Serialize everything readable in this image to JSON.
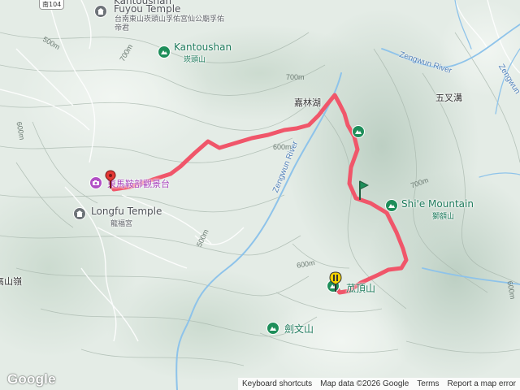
{
  "map": {
    "road_shield": "南104",
    "contours": [
      "700m",
      "700m",
      "600m",
      "600m",
      "600m",
      "500m",
      "500m",
      "700m",
      "600m"
    ],
    "rivers": {
      "zengwun_diag": "Zengwun River",
      "zengwun_top": "Zengwun River",
      "zengwun_right": "Zengwun"
    },
    "places": [
      {
        "en": "Kantoushan",
        "zh": ""
      },
      {
        "en": "Fuyou Temple",
        "zh": "台南東山崁頭山孚佑宮仙公廟孚佑帝君"
      },
      {
        "en": "Kantoushan",
        "zh": "崁頭山"
      },
      {
        "en": "",
        "zh": "嘉林湖"
      },
      {
        "en": "",
        "zh": "五叉溝"
      },
      {
        "en": "",
        "zh": "苽頂山"
      },
      {
        "en": "",
        "zh": "東馬鞍部觀景台"
      },
      {
        "en": "Longfu Temple",
        "zh": "龍福宮"
      },
      {
        "en": "Shi'e Mountain",
        "zh": "獅額山"
      },
      {
        "en": "",
        "zh": "劍文山"
      },
      {
        "en": "",
        "zh": "高山嶺"
      }
    ],
    "track_color": "#f0566a",
    "start_marker_color": "#e53935",
    "end_marker_color": "#f4d100",
    "flag_color": "#1e8e5a"
  },
  "controls": {
    "logo": "Google",
    "keyboard": "Keyboard shortcuts",
    "mapdata": "Map data ©2026 Google",
    "terms": "Terms",
    "report": "Report a map error"
  }
}
